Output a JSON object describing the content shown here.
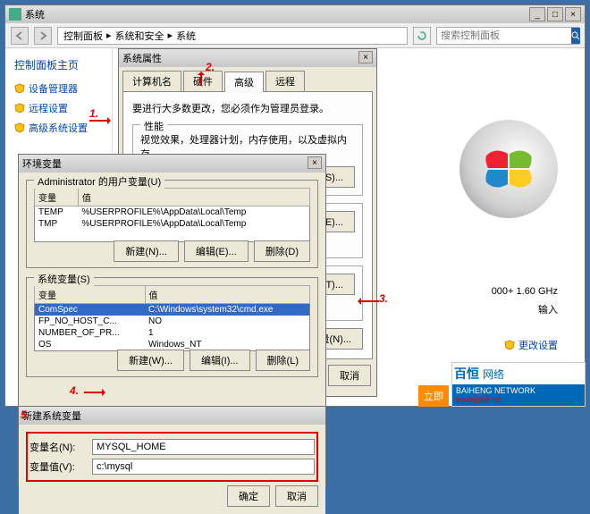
{
  "sys": {
    "title": "系统",
    "breadcrumb": [
      "控制面板",
      "系统和安全",
      "系统"
    ],
    "search_placeholder": "搜索控制面板",
    "leftpane": {
      "heading": "控制面板主页",
      "links": [
        "设备管理器",
        "远程设置",
        "高级系统设置"
      ]
    },
    "specs": {
      "cpu": "000+    1.60 GHz",
      "touch": "输入"
    },
    "seealso": "更改设置"
  },
  "sysprops": {
    "title": "系统属性",
    "tabs": [
      "计算机名",
      "硬件",
      "高级",
      "远程"
    ],
    "active_tab": 2,
    "note": "要进行大多数更改，您必须作为管理员登录。",
    "groups": [
      {
        "title": "性能",
        "desc": "视觉效果，处理器计划，内存使用，以及虚拟内存",
        "btn": "设置(S)..."
      },
      {
        "title": "",
        "desc": "",
        "btn": "设置(E)..."
      },
      {
        "title": "",
        "desc": "",
        "btn": "设置(T)..."
      }
    ],
    "env_btn": "环境变量(N)...",
    "cancel": "取消"
  },
  "envdlg": {
    "title": "环境变量",
    "user_grp": "Administrator 的用户变量(U)",
    "sys_grp": "系统变量(S)",
    "cols": [
      "变量",
      "值"
    ],
    "user_rows": [
      {
        "name": "TEMP",
        "val": "%USERPROFILE%\\AppData\\Local\\Temp"
      },
      {
        "name": "TMP",
        "val": "%USERPROFILE%\\AppData\\Local\\Temp"
      }
    ],
    "sys_rows": [
      {
        "name": "ComSpec",
        "val": "C:\\Windows\\system32\\cmd.exe"
      },
      {
        "name": "FP_NO_HOST_C...",
        "val": "NO"
      },
      {
        "name": "NUMBER_OF_PR...",
        "val": "1"
      },
      {
        "name": "OS",
        "val": "Windows_NT"
      }
    ],
    "btns": {
      "new": "新建(N)...",
      "edit": "编辑(E)...",
      "del_d": "删除(D)",
      "new_w": "新建(W)...",
      "edit_i": "编辑(I)...",
      "del_l": "删除(L)"
    }
  },
  "newvar": {
    "title": "新建系统变量",
    "name_label": "变量名(N):",
    "val_label": "变量值(V):",
    "name_value": "MYSQL_HOME",
    "val_value": "c:\\mysql",
    "ok": "确定",
    "cancel": "取消"
  },
  "anno": {
    "a1": "1.",
    "a2": "2.",
    "a3": "3.",
    "a4": "4.",
    "a5": "5."
  },
  "ad": {
    "brand": "百恒",
    "suffix": "网络",
    "sub": "BAIHENG  NETWORK",
    "url": "www.jxbh.cn",
    "cta": "立即"
  }
}
